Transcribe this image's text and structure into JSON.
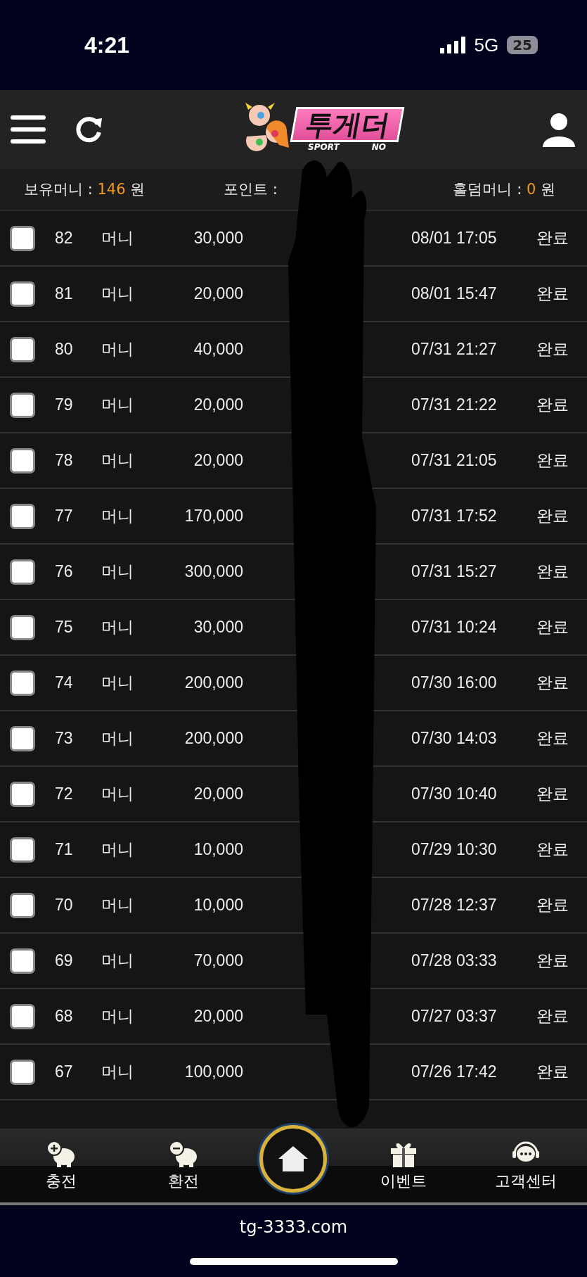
{
  "status_bar": {
    "time": "4:21",
    "network": "5G",
    "battery": "25"
  },
  "header": {
    "logo": {
      "title": "투게더",
      "subtitle_left": "SPORT",
      "subtitle_right": "NO"
    }
  },
  "balance_bar": [
    {
      "label": "보유머니 :",
      "value": "146",
      "unit": "원"
    },
    {
      "label": "포인트 :"
    },
    {
      "label": "홀덤머니 :",
      "value": "0",
      "unit": "원"
    }
  ],
  "rows": [
    {
      "checked": false,
      "number": "82",
      "type": "머니",
      "amount": "30,000",
      "date": "08/01 17:05",
      "status": "완료"
    },
    {
      "checked": false,
      "number": "81",
      "type": "머니",
      "amount": "20,000",
      "date": "08/01 15:47",
      "status": "완료"
    },
    {
      "checked": false,
      "number": "80",
      "type": "머니",
      "amount": "40,000",
      "date": "07/31 21:27",
      "status": "완료"
    },
    {
      "checked": false,
      "number": "79",
      "type": "머니",
      "amount": "20,000",
      "date": "07/31 21:22",
      "status": "완료"
    },
    {
      "checked": false,
      "number": "78",
      "type": "머니",
      "amount": "20,000",
      "date": "07/31 21:05",
      "status": "완료"
    },
    {
      "checked": false,
      "number": "77",
      "type": "머니",
      "amount": "170,000",
      "date": "07/31 17:52",
      "status": "완료"
    },
    {
      "checked": false,
      "number": "76",
      "type": "머니",
      "amount": "300,000",
      "date": "07/31 15:27",
      "status": "완료"
    },
    {
      "checked": false,
      "number": "75",
      "type": "머니",
      "amount": "30,000",
      "date": "07/31 10:24",
      "status": "완료"
    },
    {
      "checked": false,
      "number": "74",
      "type": "머니",
      "amount": "200,000",
      "date": "07/30 16:00",
      "status": "완료"
    },
    {
      "checked": false,
      "number": "73",
      "type": "머니",
      "amount": "200,000",
      "date": "07/30 14:03",
      "status": "완료"
    },
    {
      "checked": false,
      "number": "72",
      "type": "머니",
      "amount": "20,000",
      "date": "07/30 10:40",
      "status": "완료"
    },
    {
      "checked": false,
      "number": "71",
      "type": "머니",
      "amount": "10,000",
      "date": "07/29 10:30",
      "status": "완료"
    },
    {
      "checked": false,
      "number": "70",
      "type": "머니",
      "amount": "10,000",
      "date": "07/28 12:37",
      "status": "완료"
    },
    {
      "checked": false,
      "number": "69",
      "type": "머니",
      "amount": "70,000",
      "date": "07/28 03:33",
      "status": "완료"
    },
    {
      "checked": false,
      "number": "68",
      "type": "머니",
      "amount": "20,000",
      "date": "07/27 03:37",
      "status": "완료"
    },
    {
      "checked": false,
      "number": "67",
      "type": "머니",
      "amount": "100,000",
      "date": "07/26 17:42",
      "status": "완료"
    }
  ],
  "bottom_nav": [
    {
      "kind": "deposit",
      "label": "충전"
    },
    {
      "kind": "withdraw",
      "label": "환전"
    },
    {
      "kind": "home"
    },
    {
      "kind": "event",
      "label": "이벤트"
    },
    {
      "kind": "support",
      "label": "고객센터"
    }
  ],
  "browser_bar": {
    "url": "tg-3333.com"
  }
}
